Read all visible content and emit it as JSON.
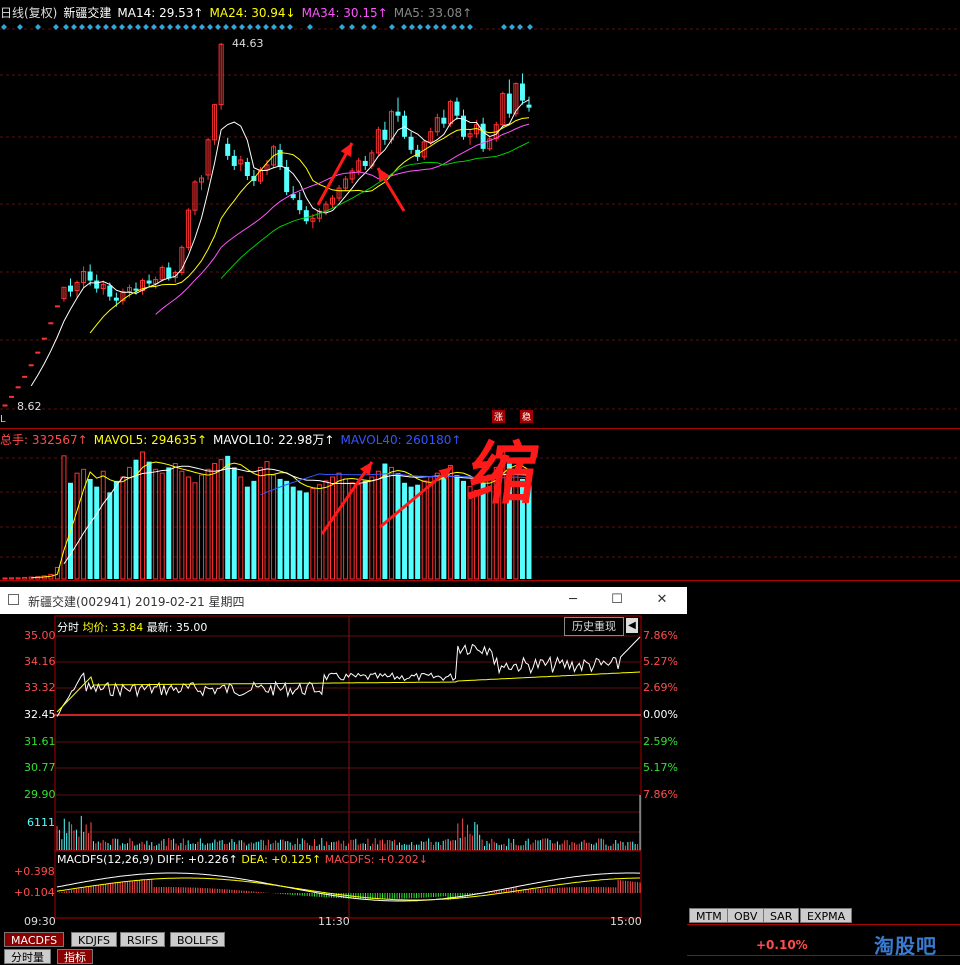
{
  "kline_header": {
    "title": "日线(复权)",
    "stock": "新疆交建",
    "ma14": "MA14: 29.53↑",
    "ma24": "MA24: 30.94↓",
    "ma34": "MA34: 30.15↑",
    "ma5": "MA5: 33.08↑"
  },
  "kline": {
    "high_label": "44.63",
    "low_label": "8.62",
    "corner_mark": "L"
  },
  "vol_header": {
    "total": "总手: 332567↑",
    "mavol5": "MAVOL5: 294635↑",
    "mavol10": "MAVOL10: 22.98万↑",
    "mavol40": "MAVOL40: 260180↑"
  },
  "annotations": {
    "zhang": "涨",
    "wen": "稳",
    "suo": "缩"
  },
  "window": {
    "title": "新疆交建(002941) 2019-02-21 星期四",
    "min": "─",
    "max": "☐",
    "close": "✕"
  },
  "intraday": {
    "header_label": "分时",
    "avg_label": "均价: 33.84",
    "latest_label": "最新: 35.00",
    "history_button": "历史重现",
    "prices_left": [
      "35.00",
      "34.16",
      "33.32",
      "32.45",
      "31.61",
      "30.77",
      "29.90"
    ],
    "pct_right": [
      "7.86%",
      "5.27%",
      "2.69%",
      "0.00%",
      "2.59%",
      "5.17%",
      "7.86%"
    ],
    "vol_label": "6111",
    "macd_header": "MACDFS(12,26,9)",
    "diff": "DIFF: +0.226↑",
    "dea": "DEA: +0.125↑",
    "macdfs": "MACDFS: +0.202↓",
    "macd_levels": [
      "+0.398",
      "+0.104"
    ],
    "times": [
      "09:30",
      "11:30",
      "15:00"
    ]
  },
  "bottom_tabs": [
    "MACDFS",
    "KDJFS",
    "RSIFS",
    "BOLLFS"
  ],
  "bottom_tabs2": [
    "分时量",
    "指标"
  ],
  "right_tabs": [
    "MTM",
    "OBV",
    "SAR",
    "EXPMA"
  ],
  "right_value": "+0.10%",
  "watermark": "淘股吧",
  "colors": {
    "up": "#ff3232",
    "down": "#54ffff",
    "ma14": "#ffffff",
    "ma24": "#ffff00",
    "ma34": "#ff55ff",
    "ma5": "#00cc00",
    "mavol40": "#3355ff"
  },
  "chart_data": {
    "type": "candlestick",
    "candles": [
      {
        "o": 8.62,
        "h": 8.62,
        "l": 8.62,
        "c": 8.62
      },
      {
        "o": 9.48,
        "h": 9.48,
        "l": 9.48,
        "c": 9.48
      },
      {
        "o": 10.43,
        "h": 10.43,
        "l": 10.43,
        "c": 10.43
      },
      {
        "o": 11.47,
        "h": 11.47,
        "l": 11.47,
        "c": 11.47
      },
      {
        "o": 12.62,
        "h": 12.62,
        "l": 12.62,
        "c": 12.62
      },
      {
        "o": 13.88,
        "h": 13.88,
        "l": 13.88,
        "c": 13.88
      },
      {
        "o": 15.27,
        "h": 15.27,
        "l": 15.27,
        "c": 15.27
      },
      {
        "o": 16.8,
        "h": 16.8,
        "l": 16.8,
        "c": 16.8
      },
      {
        "o": 18.48,
        "h": 18.48,
        "l": 18.48,
        "c": 18.48
      },
      {
        "o": 19.2,
        "h": 20.33,
        "l": 18.9,
        "c": 20.33
      },
      {
        "o": 20.5,
        "h": 21.2,
        "l": 19.4,
        "c": 19.9
      },
      {
        "o": 20.0,
        "h": 21.0,
        "l": 19.2,
        "c": 20.8
      },
      {
        "o": 20.8,
        "h": 22.4,
        "l": 20.3,
        "c": 21.9
      },
      {
        "o": 21.9,
        "h": 22.6,
        "l": 20.5,
        "c": 21.0
      },
      {
        "o": 21.0,
        "h": 21.6,
        "l": 19.8,
        "c": 20.2
      },
      {
        "o": 20.2,
        "h": 21.0,
        "l": 19.6,
        "c": 20.6
      },
      {
        "o": 20.5,
        "h": 20.8,
        "l": 19.0,
        "c": 19.4
      },
      {
        "o": 19.3,
        "h": 19.8,
        "l": 18.4,
        "c": 19.0
      },
      {
        "o": 19.0,
        "h": 20.2,
        "l": 18.6,
        "c": 19.9
      },
      {
        "o": 19.9,
        "h": 20.6,
        "l": 19.3,
        "c": 20.3
      },
      {
        "o": 20.2,
        "h": 20.8,
        "l": 19.6,
        "c": 20.0
      },
      {
        "o": 20.0,
        "h": 21.2,
        "l": 19.6,
        "c": 21.0
      },
      {
        "o": 21.0,
        "h": 21.6,
        "l": 20.4,
        "c": 20.7
      },
      {
        "o": 20.7,
        "h": 21.4,
        "l": 20.2,
        "c": 21.1
      },
      {
        "o": 21.1,
        "h": 22.5,
        "l": 20.9,
        "c": 22.3
      },
      {
        "o": 22.3,
        "h": 22.8,
        "l": 21.0,
        "c": 21.2
      },
      {
        "o": 21.3,
        "h": 22.0,
        "l": 20.8,
        "c": 21.8
      },
      {
        "o": 21.8,
        "h": 24.5,
        "l": 21.5,
        "c": 24.3
      },
      {
        "o": 24.3,
        "h": 28.2,
        "l": 24.0,
        "c": 28.0
      },
      {
        "o": 28.0,
        "h": 31.0,
        "l": 27.5,
        "c": 30.8
      },
      {
        "o": 30.8,
        "h": 31.5,
        "l": 30.0,
        "c": 31.2
      },
      {
        "o": 31.5,
        "h": 35.2,
        "l": 31.0,
        "c": 35.0
      },
      {
        "o": 35.0,
        "h": 38.6,
        "l": 34.5,
        "c": 38.5
      },
      {
        "o": 38.5,
        "h": 44.63,
        "l": 38.0,
        "c": 44.5
      },
      {
        "o": 34.6,
        "h": 35.2,
        "l": 33.0,
        "c": 33.4
      },
      {
        "o": 33.4,
        "h": 34.0,
        "l": 32.0,
        "c": 32.4
      },
      {
        "o": 32.6,
        "h": 33.4,
        "l": 31.9,
        "c": 33.0
      },
      {
        "o": 32.8,
        "h": 33.2,
        "l": 31.0,
        "c": 31.4
      },
      {
        "o": 31.4,
        "h": 32.0,
        "l": 30.4,
        "c": 30.9
      },
      {
        "o": 30.9,
        "h": 32.3,
        "l": 30.6,
        "c": 32.0
      },
      {
        "o": 32.0,
        "h": 33.0,
        "l": 31.5,
        "c": 32.5
      },
      {
        "o": 32.5,
        "h": 34.5,
        "l": 32.2,
        "c": 34.3
      },
      {
        "o": 34.0,
        "h": 34.6,
        "l": 32.0,
        "c": 32.3
      },
      {
        "o": 32.3,
        "h": 33.0,
        "l": 29.5,
        "c": 29.8
      },
      {
        "o": 29.6,
        "h": 30.4,
        "l": 29.0,
        "c": 29.2
      },
      {
        "o": 29.0,
        "h": 29.8,
        "l": 27.6,
        "c": 28.0
      },
      {
        "o": 28.0,
        "h": 28.4,
        "l": 26.6,
        "c": 26.9
      },
      {
        "o": 26.9,
        "h": 27.6,
        "l": 26.2,
        "c": 27.2
      },
      {
        "o": 27.2,
        "h": 28.2,
        "l": 26.8,
        "c": 27.9
      },
      {
        "o": 27.9,
        "h": 28.9,
        "l": 27.5,
        "c": 28.6
      },
      {
        "o": 28.6,
        "h": 29.5,
        "l": 28.2,
        "c": 29.2
      },
      {
        "o": 29.2,
        "h": 30.5,
        "l": 28.9,
        "c": 30.2
      },
      {
        "o": 30.2,
        "h": 31.4,
        "l": 30.0,
        "c": 31.1
      },
      {
        "o": 31.1,
        "h": 32.2,
        "l": 30.7,
        "c": 31.9
      },
      {
        "o": 31.9,
        "h": 33.2,
        "l": 31.5,
        "c": 32.9
      },
      {
        "o": 32.9,
        "h": 33.4,
        "l": 32.0,
        "c": 32.4
      },
      {
        "o": 32.4,
        "h": 34.0,
        "l": 32.1,
        "c": 33.7
      },
      {
        "o": 33.7,
        "h": 36.3,
        "l": 33.5,
        "c": 36.0
      },
      {
        "o": 36.0,
        "h": 36.8,
        "l": 34.5,
        "c": 35.0
      },
      {
        "o": 35.0,
        "h": 38.0,
        "l": 34.6,
        "c": 37.8
      },
      {
        "o": 37.8,
        "h": 39.2,
        "l": 36.8,
        "c": 37.4
      },
      {
        "o": 37.4,
        "h": 37.9,
        "l": 35.1,
        "c": 35.3
      },
      {
        "o": 35.3,
        "h": 35.8,
        "l": 33.6,
        "c": 34.0
      },
      {
        "o": 34.0,
        "h": 34.5,
        "l": 32.9,
        "c": 33.3
      },
      {
        "o": 33.3,
        "h": 35.0,
        "l": 33.0,
        "c": 34.8
      },
      {
        "o": 34.8,
        "h": 36.2,
        "l": 34.5,
        "c": 35.8
      },
      {
        "o": 35.8,
        "h": 37.6,
        "l": 35.4,
        "c": 37.2
      },
      {
        "o": 37.2,
        "h": 38.0,
        "l": 36.2,
        "c": 36.6
      },
      {
        "o": 36.6,
        "h": 39.0,
        "l": 36.3,
        "c": 38.8
      },
      {
        "o": 38.8,
        "h": 39.2,
        "l": 37.0,
        "c": 37.4
      },
      {
        "o": 37.4,
        "h": 38.0,
        "l": 35.0,
        "c": 35.3
      },
      {
        "o": 35.3,
        "h": 36.0,
        "l": 34.5,
        "c": 35.6
      },
      {
        "o": 35.6,
        "h": 37.0,
        "l": 35.2,
        "c": 36.5
      },
      {
        "o": 36.6,
        "h": 37.2,
        "l": 33.8,
        "c": 34.1
      },
      {
        "o": 34.1,
        "h": 35.4,
        "l": 33.9,
        "c": 35.1
      },
      {
        "o": 35.1,
        "h": 36.8,
        "l": 34.8,
        "c": 36.5
      },
      {
        "o": 36.5,
        "h": 39.8,
        "l": 36.3,
        "c": 39.6
      },
      {
        "o": 39.6,
        "h": 41.0,
        "l": 37.2,
        "c": 37.6
      },
      {
        "o": 37.6,
        "h": 40.7,
        "l": 37.3,
        "c": 40.6
      },
      {
        "o": 40.6,
        "h": 41.6,
        "l": 38.5,
        "c": 38.9
      },
      {
        "o": 38.5,
        "h": 39.3,
        "l": 37.8,
        "c": 38.2
      }
    ],
    "volume": [
      2,
      3,
      3,
      4,
      5,
      6,
      8,
      12,
      30,
      320,
      250,
      275,
      285,
      260,
      240,
      280,
      225,
      255,
      265,
      290,
      310,
      330,
      305,
      285,
      275,
      290,
      300,
      280,
      265,
      250,
      270,
      285,
      300,
      310,
      320,
      290,
      265,
      240,
      255,
      290,
      305,
      270,
      260,
      255,
      240,
      230,
      225,
      235,
      245,
      255,
      265,
      275,
      260,
      250,
      245,
      255,
      265,
      280,
      300,
      290,
      275,
      250,
      240,
      245,
      255,
      265,
      275,
      280,
      295,
      270,
      255,
      240,
      230,
      250,
      270,
      290,
      330,
      300,
      285,
      260,
      245
    ],
    "ylim": [
      8.62,
      44.63
    ]
  }
}
